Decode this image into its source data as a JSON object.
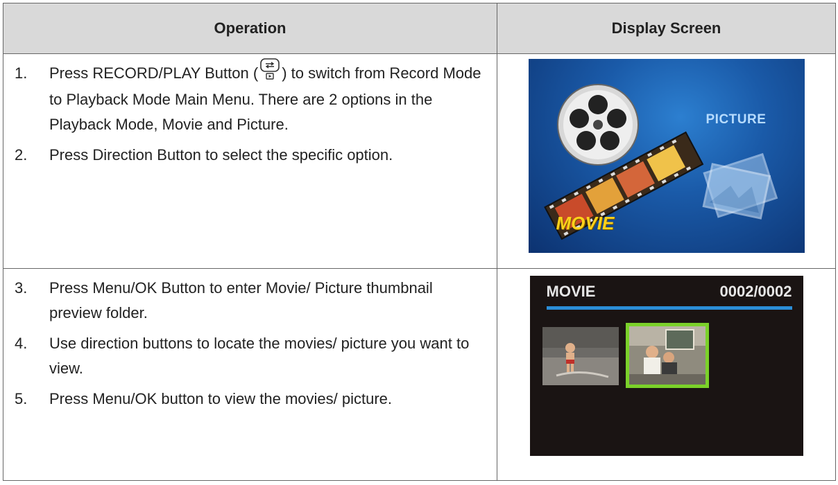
{
  "table": {
    "header_operation": "Operation",
    "header_display": "Display Screen"
  },
  "rows": [
    {
      "steps": [
        {
          "num": "1.",
          "pre": "Press RECORD/PLAY Button (",
          "icon": "record-play-button-icon",
          "post": ") to switch from Record Mode to Playback Mode Main Menu. There are 2 options in the Playback Mode, Movie and Picture."
        },
        {
          "num": "2.",
          "text": "Press Direction Button to select the specific option."
        }
      ],
      "screen": {
        "picture_label": "PICTURE",
        "movie_label": "MOVIE"
      }
    },
    {
      "steps": [
        {
          "num": "3.",
          "text": "Press Menu/OK Button to enter Movie/ Picture thumbnail preview folder."
        },
        {
          "num": "4.",
          "text": "Use direction buttons to locate the movies/ picture you want to view."
        },
        {
          "num": "5.",
          "text": "Press Menu/OK button to view the movies/ picture."
        }
      ],
      "screen": {
        "title": "MOVIE",
        "counter": "0002/0002"
      }
    }
  ],
  "colors": {
    "header_bg": "#d9d9d9",
    "menu_bg": "#1a5aa8",
    "movie_label": "#ffd21a",
    "picture_label": "#b7dcff",
    "thumb_select": "#7bd12a",
    "progress_bar": "#2b8ed8"
  }
}
